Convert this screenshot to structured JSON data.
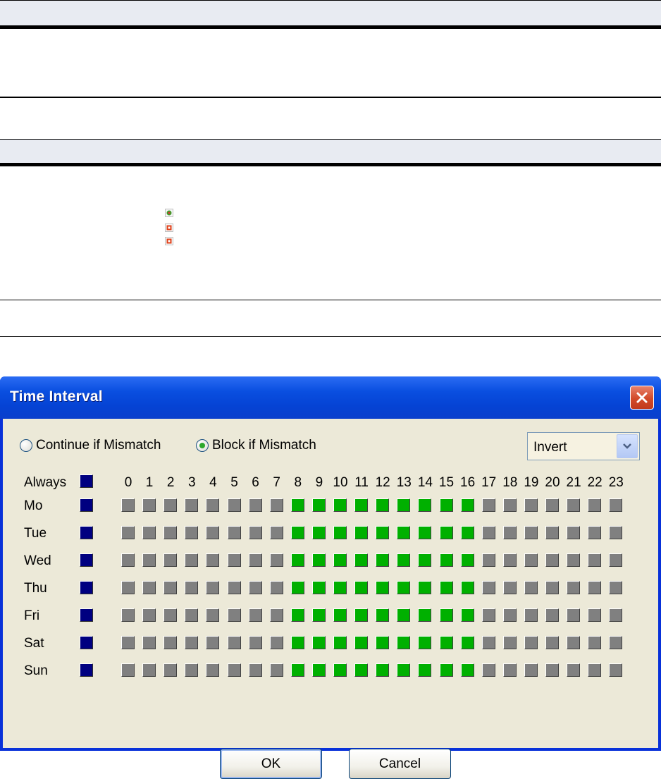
{
  "dialog": {
    "title": "Time Interval",
    "radio_continue": "Continue if Mismatch",
    "radio_block": "Block if Mismatch",
    "selected_radio": "block",
    "select_value": "Invert",
    "always_label": "Always",
    "ok_label": "OK",
    "cancel_label": "Cancel"
  },
  "schedule": {
    "hours": [
      "0",
      "1",
      "2",
      "3",
      "4",
      "5",
      "6",
      "7",
      "8",
      "9",
      "10",
      "11",
      "12",
      "13",
      "14",
      "15",
      "16",
      "17",
      "18",
      "19",
      "20",
      "21",
      "22",
      "23"
    ],
    "days": [
      "Mo",
      "Tue",
      "Wed",
      "Thu",
      "Fri",
      "Sat",
      "Sun"
    ],
    "active_from_hour": 8,
    "active_to_hour": 16
  },
  "colors": {
    "active_cell": "#00b000",
    "inactive_cell": "#808080",
    "day_toggle": "#000080"
  },
  "icons": [
    "green-status-icon",
    "red-status-icon",
    "red-status-icon"
  ]
}
